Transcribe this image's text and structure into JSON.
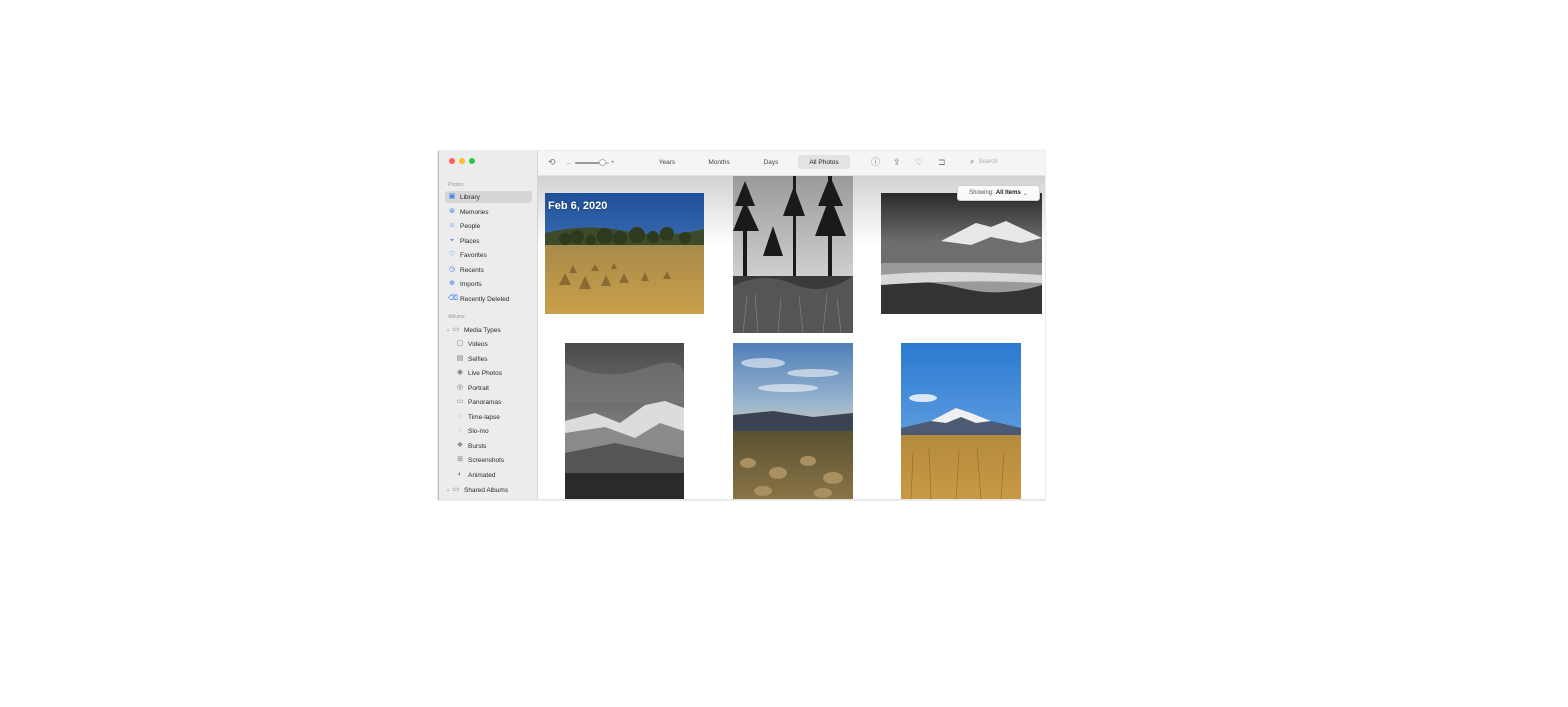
{
  "window": {
    "traffic_lights": [
      "close",
      "minimize",
      "zoom"
    ]
  },
  "sidebar": {
    "photos_header": "Photos",
    "items": [
      {
        "label": "Library",
        "icon": "library-icon",
        "selected": true
      },
      {
        "label": "Memories",
        "icon": "memories-icon"
      },
      {
        "label": "People",
        "icon": "people-icon"
      },
      {
        "label": "Places",
        "icon": "places-icon"
      },
      {
        "label": "Favorites",
        "icon": "heart-icon"
      },
      {
        "label": "Recents",
        "icon": "recents-icon"
      },
      {
        "label": "Imports",
        "icon": "imports-icon"
      },
      {
        "label": "Recently Deleted",
        "icon": "trash-icon"
      }
    ],
    "albums_header": "Albums",
    "media_types": {
      "label": "Media Types",
      "items": [
        {
          "label": "Videos",
          "icon": "video-icon"
        },
        {
          "label": "Selfies",
          "icon": "selfie-icon"
        },
        {
          "label": "Live Photos",
          "icon": "live-photo-icon"
        },
        {
          "label": "Portrait",
          "icon": "portrait-icon"
        },
        {
          "label": "Panoramas",
          "icon": "panorama-icon"
        },
        {
          "label": "Time-lapse",
          "icon": "timelapse-icon"
        },
        {
          "label": "Slo-mo",
          "icon": "slomo-icon"
        },
        {
          "label": "Bursts",
          "icon": "burst-icon"
        },
        {
          "label": "Screenshots",
          "icon": "screenshot-icon"
        },
        {
          "label": "Animated",
          "icon": "animated-icon"
        }
      ]
    },
    "shared_albums": {
      "label": "Shared Albums"
    }
  },
  "toolbar": {
    "tabs": [
      {
        "label": "Years"
      },
      {
        "label": "Months"
      },
      {
        "label": "Days"
      },
      {
        "label": "All Photos",
        "active": true
      }
    ],
    "zoom_fraction": 0.8,
    "search_placeholder": "Search",
    "icons": [
      "rotate-icon",
      "info-icon",
      "share-icon",
      "heart-icon",
      "add-to-album-icon",
      "search-icon"
    ]
  },
  "content": {
    "date_label": "Feb 6, 2020",
    "showing_label": "Showing:",
    "showing_value": "All Items",
    "colors": {
      "accent": "#2d7cf5",
      "sidebar_bg": "#ececec"
    }
  }
}
